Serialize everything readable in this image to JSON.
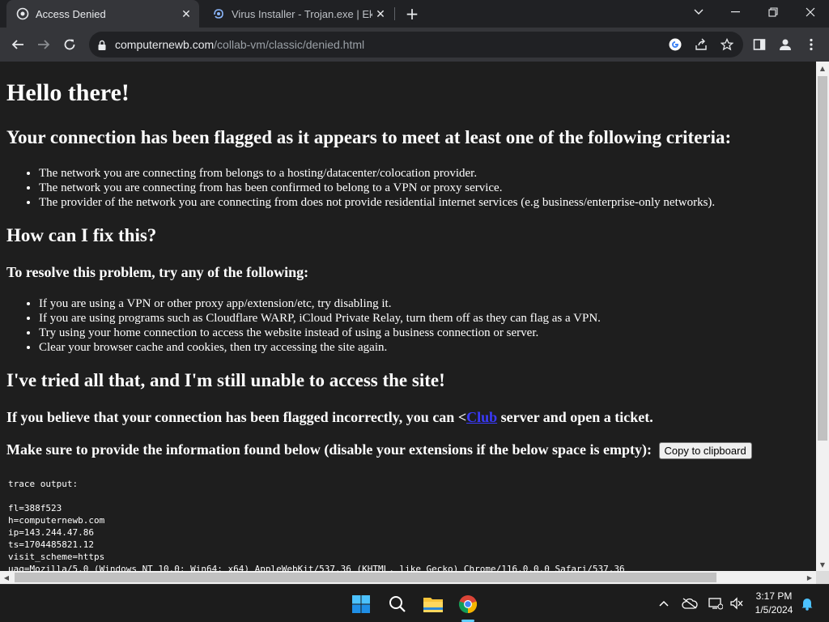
{
  "browser": {
    "tabs": [
      {
        "title": "Access Denied",
        "active": true,
        "favicon": "page-icon"
      },
      {
        "title": "Virus Installer - Trojan.exe | Ektop",
        "active": false,
        "favicon": "ektoplasma-icon"
      }
    ],
    "url_host": "computernewb.com",
    "url_path": "/collab-vm/classic/denied.html"
  },
  "page": {
    "h1": "Hello there!",
    "flag_heading": "Your connection has been flagged as it appears to meet at least one of the following criteria:",
    "criteria": [
      "The network you are connecting from belongs to a hosting/datacenter/colocation provider.",
      "The network you are connecting from has been confirmed to belong to a VPN or proxy service.",
      "The provider of the network you are connecting from does not provide residential internet services (e.g business/enterprise-only networks)."
    ],
    "fix_heading": "How can I fix this?",
    "resolve_heading": "To resolve this problem, try any of the following:",
    "fixes": [
      "If you are using a VPN or other proxy app/extension/etc, try disabling it.",
      "If you are using programs such as Cloudflare WARP, iCloud Private Relay, turn them off as they can flag as a VPN.",
      "Try using your home connection to access the website instead of using a business connection or server.",
      "Clear your browser cache and cookies, then try accessing the site again."
    ],
    "tried_heading": "I've tried all that, and I'm still unable to access the site!",
    "incorrect_prefix": "If you believe that your connection has been flagged incorrectly, you can <",
    "incorrect_link": "Club",
    "incorrect_suffix": " server and open a ticket.",
    "info_text": "Make sure to provide the information found below (disable your extensions if the below space is empty):",
    "copy_button": "Copy to clipboard",
    "trace_lines": [
      "trace output:",
      "",
      "fl=388f523",
      "h=computernewb.com",
      "ip=143.244.47.86",
      "ts=1704485821.12",
      "visit_scheme=https",
      "uag=Mozilla/5.0 (Windows NT 10.0; Win64; x64) AppleWebKit/537.36 (KHTML, like Gecko) Chrome/116.0.0.0 Safari/537.36"
    ]
  },
  "taskbar": {
    "time": "3:17 PM",
    "date": "1/5/2024"
  },
  "colors": {
    "page_bg": "#1e1e1e",
    "chrome_dark": "#202124",
    "toolbar": "#35363a",
    "link": "#3a3aff",
    "taskbar_accent": "#60cdff"
  }
}
